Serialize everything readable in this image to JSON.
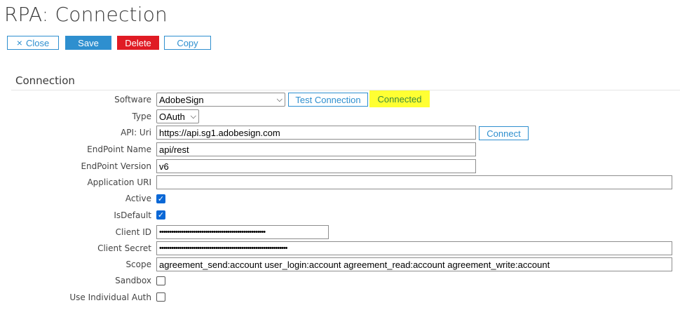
{
  "page": {
    "title": "RPA: Connection"
  },
  "toolbar": {
    "close_label": "Close",
    "save_label": "Save",
    "delete_label": "Delete",
    "copy_label": "Copy",
    "close_icon": "×"
  },
  "section": {
    "title": "Connection"
  },
  "form": {
    "software": {
      "label": "Software",
      "value": "AdobeSign"
    },
    "test_connection_label": "Test Connection",
    "status_text": "Connected",
    "type": {
      "label": "Type",
      "value": "OAuth"
    },
    "api_uri": {
      "label": "API: Uri",
      "value": "https://api.sg1.adobesign.com"
    },
    "connect_label": "Connect",
    "endpoint_name": {
      "label": "EndPoint Name",
      "value": "api/rest"
    },
    "endpoint_version": {
      "label": "EndPoint Version",
      "value": "v6"
    },
    "application_uri": {
      "label": "Application URI",
      "value": ""
    },
    "active": {
      "label": "Active",
      "checked": true
    },
    "is_default": {
      "label": "IsDefault",
      "checked": true
    },
    "client_id": {
      "label": "Client ID",
      "value": "•••••••••••••••••••••••••••••••••••••••••••••••••••••"
    },
    "client_secret": {
      "label": "Client Secret",
      "value": "••••••••••••••••••••••••••••••••••••••••••••••••••••••••••••••••"
    },
    "scope": {
      "label": "Scope",
      "value": "agreement_send:account user_login:account agreement_read:account agreement_write:account"
    },
    "sandbox": {
      "label": "Sandbox",
      "checked": false
    },
    "use_individual_auth": {
      "label": "Use Individual Auth",
      "checked": false
    }
  },
  "colors": {
    "accent": "#2e8fcf",
    "danger": "#e01b24",
    "highlight": "#ffff33",
    "success_text": "#3b8a3b"
  }
}
